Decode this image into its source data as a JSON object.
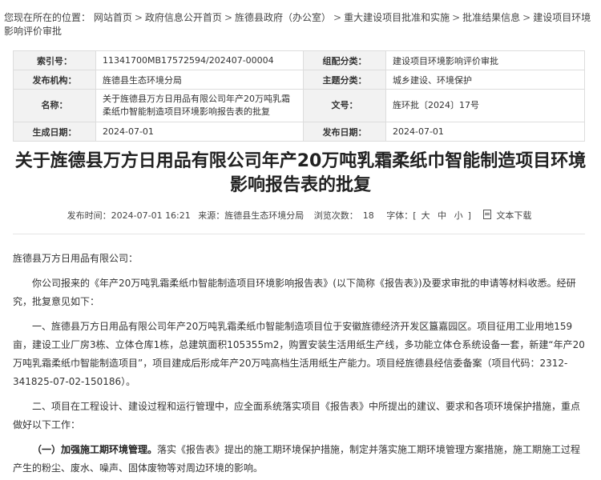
{
  "breadcrumb": {
    "prefix": "您现在所在的位置：",
    "items": [
      "网站首页",
      "政府信息公开首页",
      "旌德县政府（办公室）",
      "重大建设项目批准和实施",
      "批准结果信息",
      "建设项目环境影响评价审批"
    ],
    "sep": ">"
  },
  "meta": {
    "index_label": "索引号：",
    "index_value": "11341700MB17572594/202407-00004",
    "category_label": "组配分类：",
    "category_value": "建设项目环境影响评价审批",
    "publisher_label": "发布机构：",
    "publisher_value": "旌德县生态环境分局",
    "topic_label": "主题分类：",
    "topic_value": "城乡建设、环境保护",
    "name_label": "名称：",
    "name_value": "关于旌德县万方日用品有限公司年产20万吨乳霜柔纸巾智能制造项目环境影响报告表的批复",
    "docno_label": "文号：",
    "docno_value": "旌环批〔2024〕17号",
    "created_label": "生成日期：",
    "created_value": "2024-07-01",
    "published_label": "发布日期：",
    "published_value": "2024-07-01"
  },
  "article": {
    "title": "关于旌德县万方日用品有限公司年产20万吨乳霜柔纸巾智能制造项目环境影响报告表的批复",
    "publish_time": "发布时间：2024-07-01 16:21",
    "source": "来源：旌德县生态环境分局",
    "views_label": "浏览次数：",
    "views_value": "18",
    "font_size_label": "字体：[",
    "font_large": "大",
    "font_medium": "中",
    "font_small": "小",
    "font_size_close": "]",
    "download": "文本下载"
  },
  "body": {
    "salutation": "旌德县万方日用品有限公司：",
    "p1": "你公司报来的《年产20万吨乳霜柔纸巾智能制造项目环境影响报告表》(以下简称《报告表》)及要求审批的申请等材料收悉。经研究，批复意见如下：",
    "p2": "一、旌德县万方日用品有限公司年产20万吨乳霜柔纸巾智能制造项目位于安徽旌德经济开发区簋嘉园区。项目征用工业用地159亩，建设工业厂房3栋、立体仓库1栋，总建筑面积105355m2，购置安装生活用纸生产线，多功能立体仓系统设备一套，新建“年产20万吨乳霜柔纸巾智能制造项目”，项目建成后形成年产20万吨高档生活用纸生产能力。项目经旌德县经信委备案（项目代码：2312-341825-07-02-150186）。",
    "p3": "二、项目在工程设计、建设过程和运行管理中，应全面系统落实项目《报告表》中所提出的建议、要求和各项环境保护措施，重点做好以下工作：",
    "p4_bold": "（一）加强施工期环境管理。",
    "p4_rest": "落实《报告表》提出的施工期环境保护措施，制定并落实施工期环境管理方案措施，施工期施工过程产生的粉尘、废水、噪声、固体废物等对周边环境的影响。"
  }
}
